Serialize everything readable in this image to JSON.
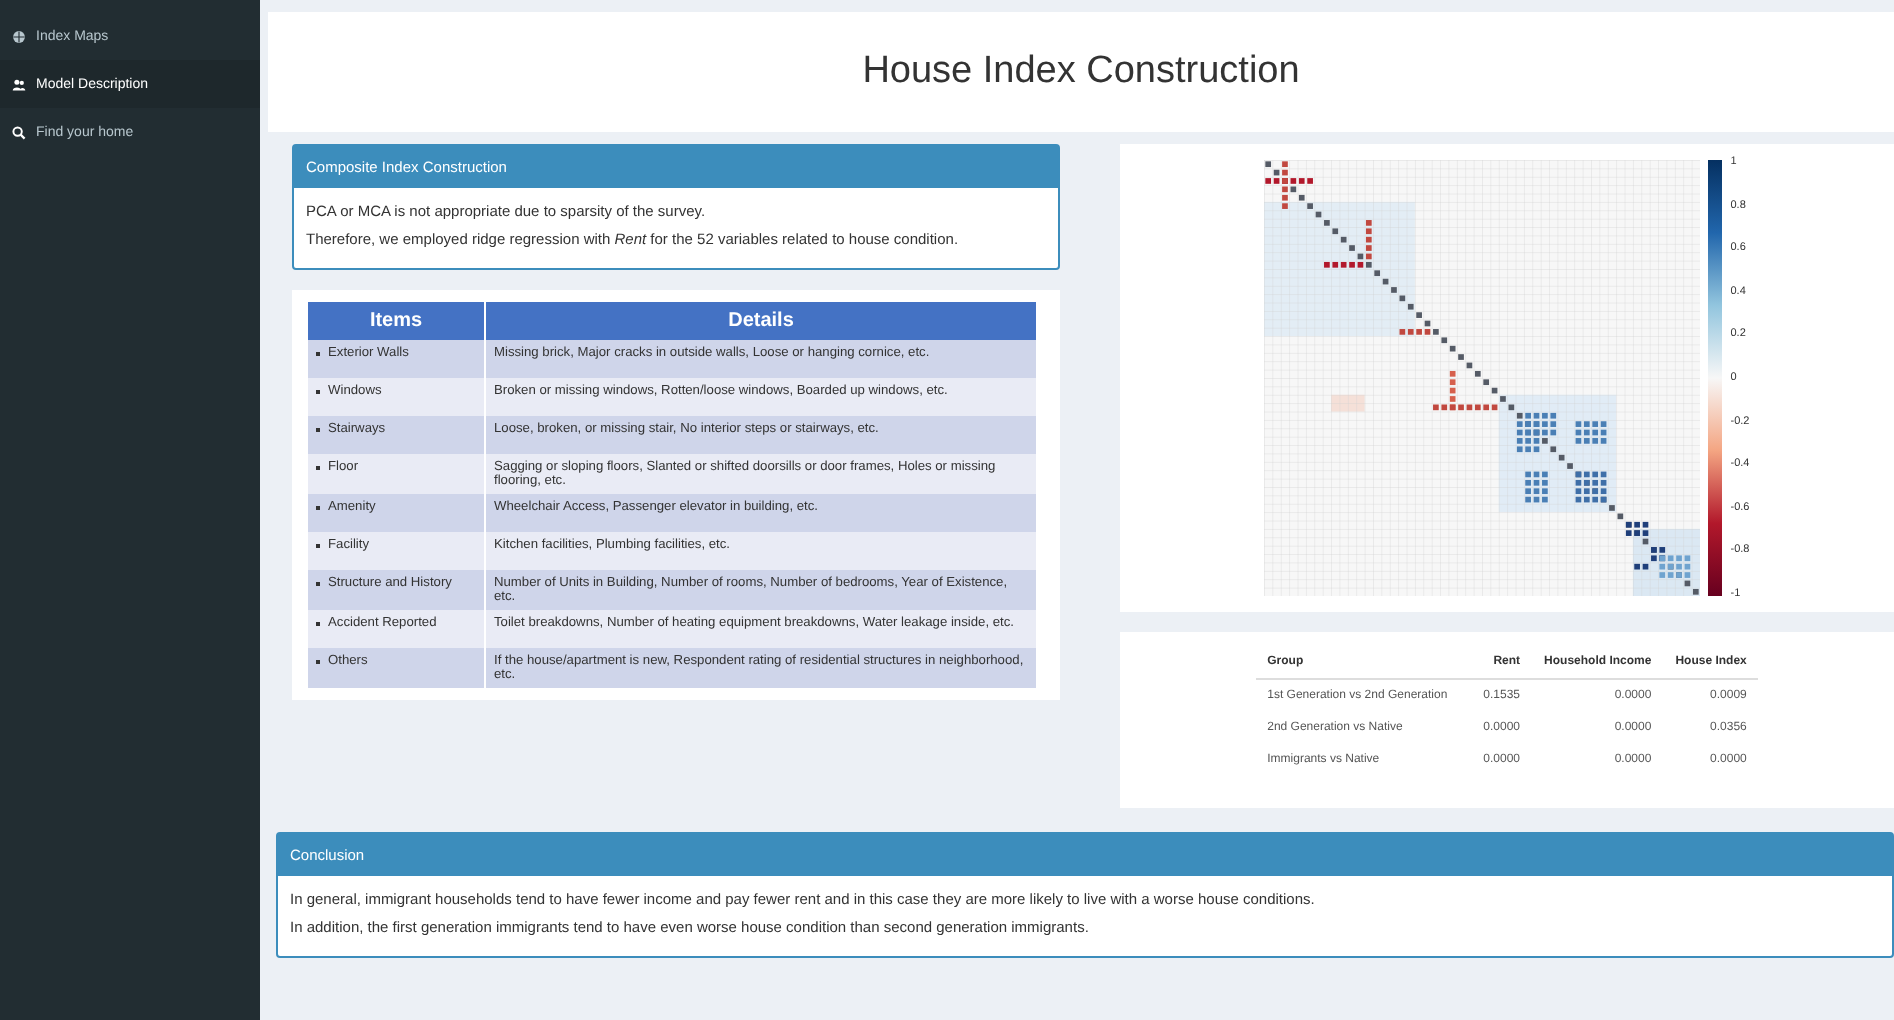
{
  "sidebar": {
    "items": [
      {
        "label": "Index Maps",
        "selected": false
      },
      {
        "label": "Model Description",
        "selected": true
      },
      {
        "label": "Find your home",
        "selected": false
      }
    ]
  },
  "page_title": "House Index Construction",
  "composite_box": {
    "title": "Composite Index Construction",
    "paragraphs": [
      "PCA or MCA is not appropriate due to sparsity of the survey.",
      "Therefore, we employed ridge regression with *Rent* for the 52 variables related to house condition."
    ]
  },
  "items_table": {
    "columns": [
      "Items",
      "Details"
    ],
    "rows": [
      {
        "item": "Exterior Walls",
        "details": "Missing brick, Major cracks in outside walls, Loose or hanging cornice, etc."
      },
      {
        "item": "Windows",
        "details": "Broken or missing windows, Rotten/loose windows, Boarded up windows, etc."
      },
      {
        "item": "Stairways",
        "details": "Loose, broken, or missing stair, No interior steps or stairways, etc."
      },
      {
        "item": "Floor",
        "details": "Sagging or sloping floors, Slanted or shifted doorsills or door frames, Holes or missing flooring, etc."
      },
      {
        "item": "Amenity",
        "details": "Wheelchair Access, Passenger elevator in building, etc."
      },
      {
        "item": "Facility",
        "details": "Kitchen facilities, Plumbing facilities, etc."
      },
      {
        "item": "Structure and History",
        "details": "Number of Units in Building, Number of rooms, Number of bedrooms, Year of Existence, etc."
      },
      {
        "item": "Accident Reported",
        "details": "Toilet breakdowns, Number of heating equipment breakdowns, Water leakage inside, etc."
      },
      {
        "item": "Others",
        "details": "If the house/apartment is new, Respondent rating of residential structures in neighborhood, etc."
      }
    ]
  },
  "correlation_plot": {
    "colorbar_ticks": [
      "1",
      "0.8",
      "0.6",
      "0.4",
      "0.2",
      "0",
      "-0.2",
      "-0.4",
      "-0.6",
      "-0.8",
      "-1"
    ]
  },
  "pvalue_table": {
    "columns": [
      "Group",
      "Rent",
      "Household Income",
      "House Index"
    ],
    "rows": [
      [
        "1st Generation vs 2nd Generation",
        "0.1535",
        "0.0000",
        "0.0009"
      ],
      [
        "2nd Generation vs Native",
        "0.0000",
        "0.0000",
        "0.0356"
      ],
      [
        "Immigrants vs Native",
        "0.0000",
        "0.0000",
        "0.0000"
      ]
    ]
  },
  "conclusion_box": {
    "title": "Conclusion",
    "paragraphs": [
      "In general, immigrant households tend to have fewer income and pay fewer rent and in this case they are more likely to live with a worse house conditions.",
      "In addition, the first generation immigrants tend to have even worse house condition than second generation immigrants."
    ]
  }
}
